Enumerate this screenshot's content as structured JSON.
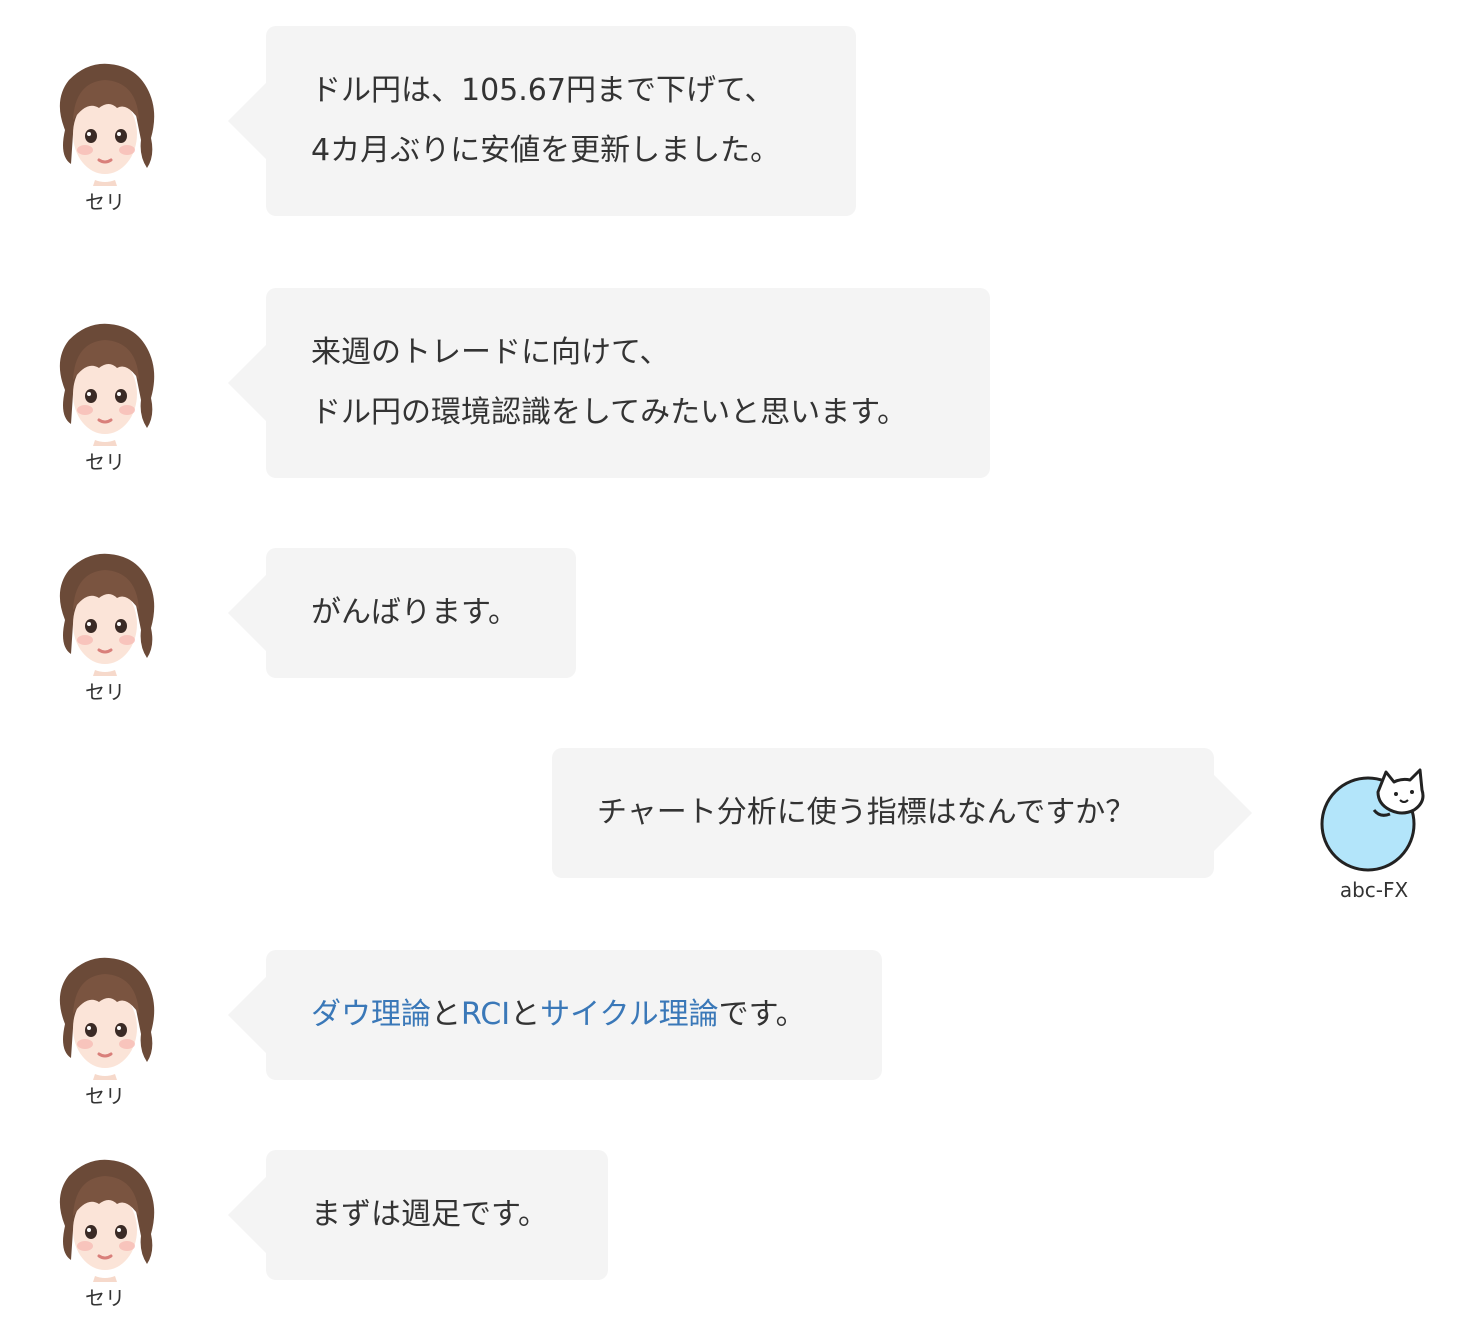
{
  "colors": {
    "bubble_bg": "#f4f4f4",
    "text": "#333333",
    "keyword_link": "#3a78b8",
    "cat_fill": "#b3e5fa"
  },
  "speakers": {
    "seri": {
      "name": "セリ",
      "avatar_icon": "girl-avatar-icon"
    },
    "user": {
      "name": "abc-FX",
      "avatar_icon": "cat-avatar-icon"
    }
  },
  "messages": [
    {
      "speaker": "セリ",
      "lines": [
        "ドル円は、105.67円まで下げて、",
        "4カ月ぶりに安値を更新しました。"
      ]
    },
    {
      "speaker": "セリ",
      "lines": [
        "来週のトレードに向けて、",
        "ドル円の環境認識をしてみたいと思います。"
      ]
    },
    {
      "speaker": "セリ",
      "lines": [
        "がんばります。"
      ]
    },
    {
      "speaker": "abc-FX",
      "lines": [
        "チャート分析に使う指標はなんですか？"
      ]
    },
    {
      "speaker": "セリ",
      "parts": [
        {
          "text": "ダウ理論",
          "link": true
        },
        {
          "text": "と",
          "link": false
        },
        {
          "text": "RCI",
          "link": true
        },
        {
          "text": "と",
          "link": false
        },
        {
          "text": "サイクル理論",
          "link": true
        },
        {
          "text": "です。",
          "link": false
        }
      ]
    },
    {
      "speaker": "セリ",
      "lines": [
        "まずは週足です。"
      ]
    }
  ]
}
